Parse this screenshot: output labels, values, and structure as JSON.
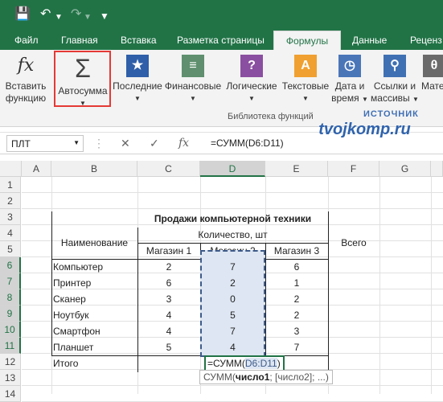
{
  "qat": {
    "save_icon": "save-icon",
    "undo_icon": "undo-icon",
    "redo_icon": "redo-icon",
    "more_icon": "chevron-down-icon"
  },
  "tabs": [
    "Файл",
    "Главная",
    "Вставка",
    "Разметка страницы",
    "Формулы",
    "Данные",
    "Реценз"
  ],
  "active_tab": "Формулы",
  "ribbon": {
    "insert_fn": {
      "label1": "Вставить",
      "label2": "функцию",
      "icon": "fx"
    },
    "autosum": {
      "label": "Автосумма",
      "icon": "Σ"
    },
    "recent": {
      "label": "Последние"
    },
    "financial": {
      "label": "Финансовые"
    },
    "logical": {
      "label": "Логические",
      "icon": "?"
    },
    "text": {
      "label": "Текстовые",
      "icon": "A"
    },
    "datetime": {
      "label1": "Дата и",
      "label2": "время"
    },
    "lookup": {
      "label1": "Ссылки и",
      "label2": "массивы"
    },
    "math": {
      "label": "Мате"
    },
    "group_label": "Библиотека функций"
  },
  "watermark": {
    "top": "ИСТОЧНИК",
    "site": "tvojkomp.ru"
  },
  "formula_bar": {
    "name_box": "ПЛТ",
    "cancel": "✕",
    "enter": "✓",
    "fx": "fx",
    "formula": "=СУММ(D6:D11)"
  },
  "columns": [
    "A",
    "B",
    "C",
    "D",
    "E",
    "F",
    "G"
  ],
  "rows": [
    "1",
    "2",
    "3",
    "4",
    "5",
    "6",
    "7",
    "8",
    "9",
    "10",
    "11",
    "12",
    "13",
    "14"
  ],
  "table": {
    "title": "Продажи компьютерной техники",
    "header_name": "Наименование",
    "header_qty": "Количество, шт",
    "header_total": "Всего",
    "stores": [
      "Магазин 1",
      "Магазин 2",
      "Магазин 3"
    ],
    "items": [
      {
        "name": "Компьютер",
        "v": [
          "2",
          "7",
          "6"
        ]
      },
      {
        "name": "Принтер",
        "v": [
          "6",
          "2",
          "1"
        ]
      },
      {
        "name": "Сканер",
        "v": [
          "3",
          "0",
          "2"
        ]
      },
      {
        "name": "Ноутбук",
        "v": [
          "4",
          "5",
          "2"
        ]
      },
      {
        "name": "Смартфон",
        "v": [
          "4",
          "7",
          "3"
        ]
      },
      {
        "name": "Планшет",
        "v": [
          "5",
          "4",
          "7"
        ]
      }
    ],
    "total_label": "Итого",
    "total_formula_prefix": "=СУММ(",
    "total_formula_ref": "D6:D11",
    "total_formula_suffix": ")"
  },
  "tooltip": {
    "fn": "СУММ(",
    "arg1": "число1",
    "rest": "; [число2]; ...)"
  },
  "colors": {
    "excel_green": "#217346",
    "selection_red": "#e53935",
    "range_blue": "#3d5a89"
  }
}
